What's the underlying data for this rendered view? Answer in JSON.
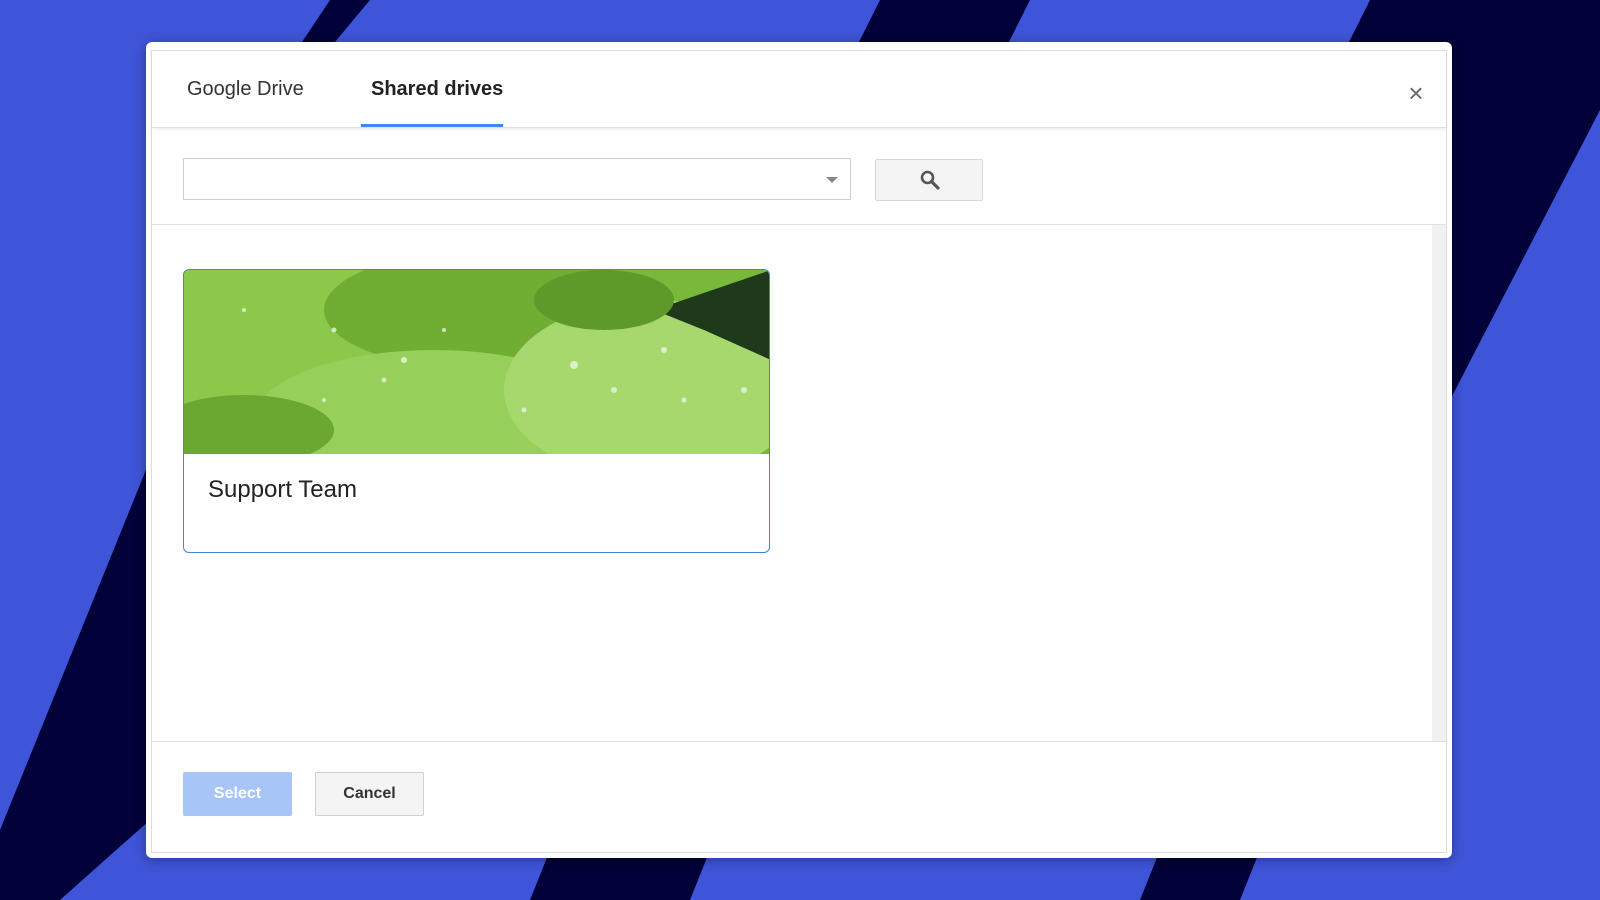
{
  "tabs": [
    {
      "label": "Google Drive",
      "active": false
    },
    {
      "label": "Shared drives",
      "active": true
    }
  ],
  "close_label": "×",
  "search": {
    "value": "",
    "placeholder": ""
  },
  "drives": [
    {
      "name": "Support Team",
      "selected": true,
      "theme": "green-leaves-photo"
    }
  ],
  "footer": {
    "select_label": "Select",
    "cancel_label": "Cancel"
  },
  "colors": {
    "background": "#3f55d9",
    "background_stripe": "#02023a",
    "accent": "#4285f4",
    "select_disabled": "#a8c5f7"
  },
  "icons": {
    "search": "search-icon",
    "close": "close-icon",
    "dropdown": "chevron-down-icon"
  }
}
